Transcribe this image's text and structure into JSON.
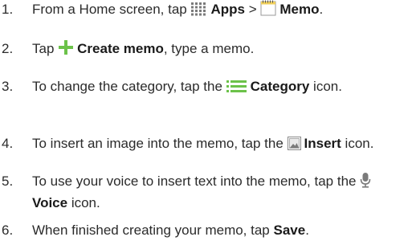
{
  "steps": [
    {
      "num": "1.",
      "pre": "From a Home screen, tap ",
      "icon1": "apps-grid-icon",
      "bold1": "Apps",
      "sep": " > ",
      "icon2": "memo-icon",
      "bold2": "Memo",
      "post": "."
    },
    {
      "num": "2.",
      "pre": "Tap ",
      "icon": "plus-icon",
      "bold": "Create memo",
      "post": ", type a memo."
    },
    {
      "num": "3.",
      "pre": "To change the category, tap the ",
      "icon": "category-list-icon",
      "bold": "Category",
      "post": " icon."
    },
    {
      "num": "4.",
      "pre": "To insert an image into the memo, tap the ",
      "icon": "image-insert-icon",
      "bold": "Insert",
      "post": " icon."
    },
    {
      "num": "5.",
      "pre": "To use your voice to insert text into the memo, tap the ",
      "icon": "microphone-icon",
      "bold": "Voice",
      "post": " icon."
    },
    {
      "num": "6.",
      "pre": "When finished creating your memo, tap ",
      "bold": "Save",
      "post": "."
    }
  ],
  "colors": {
    "text": "#2b2b2b",
    "icon_green": "#6cc24a",
    "icon_gray": "#7a7a7a",
    "memo_yellow": "#f2d15c"
  }
}
